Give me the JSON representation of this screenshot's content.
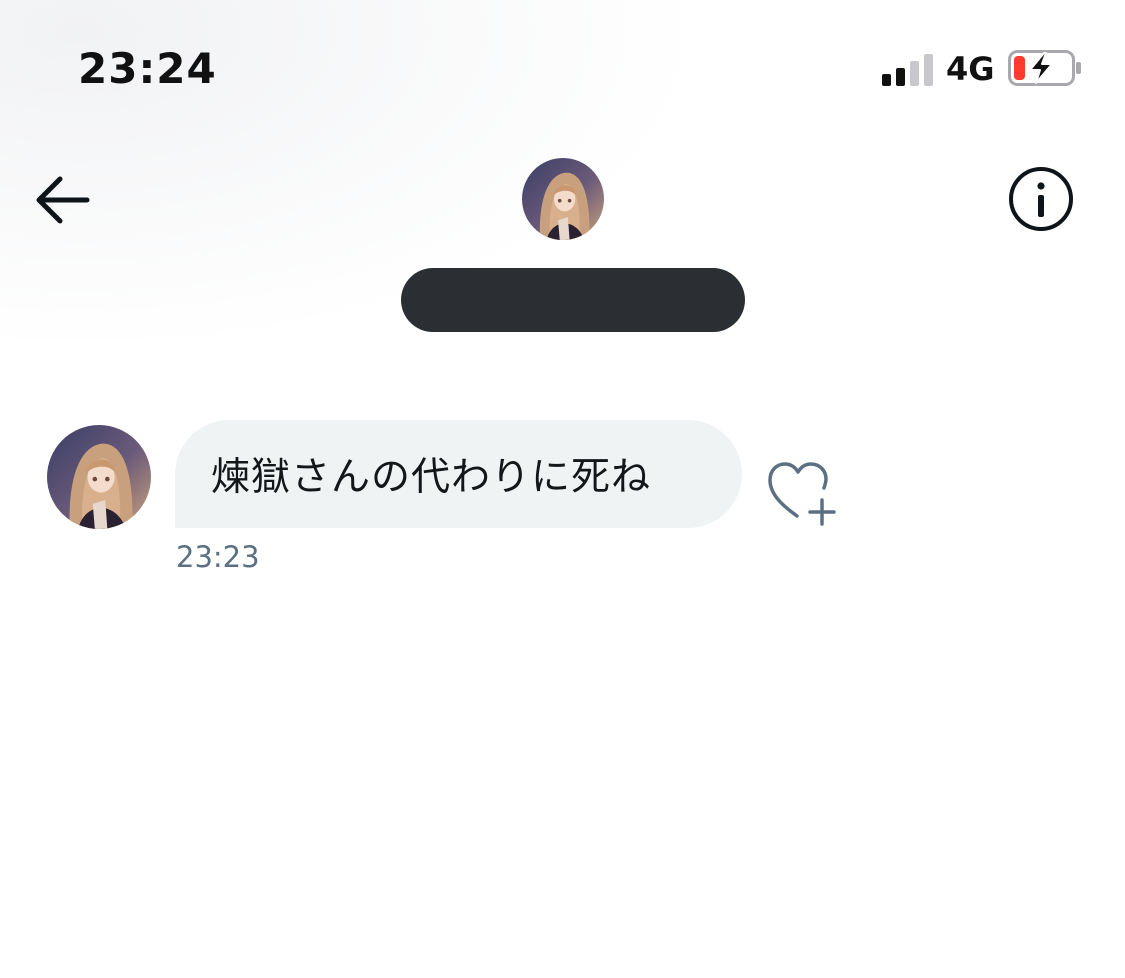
{
  "status_bar": {
    "time": "23:24",
    "network": "4G",
    "signal_bars_active": 2,
    "signal_bars_total": 4,
    "battery_charging": true,
    "battery_low_color": "#ff3b30"
  },
  "header": {
    "back_icon": "arrow-left-icon",
    "info_icon": "info-icon",
    "name_redacted": true
  },
  "messages": [
    {
      "text": "煉獄さんの代わりに死ね",
      "time": "23:23",
      "direction": "incoming",
      "reaction_icon": "heart-plus-icon"
    }
  ],
  "colors": {
    "bubble_incoming": "#eff3f4",
    "timestamp": "#5b7083",
    "icon_stroke": "#5b7083",
    "redaction": "#2b2f33"
  }
}
